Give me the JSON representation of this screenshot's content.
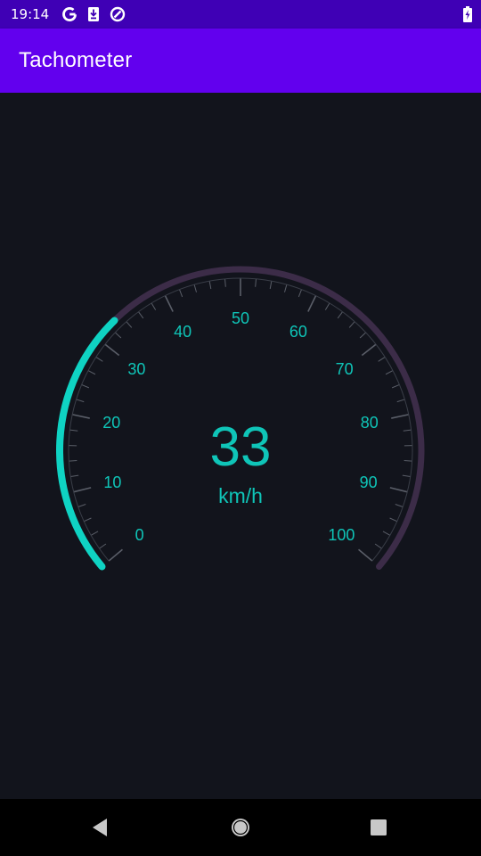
{
  "status_bar": {
    "time": "19:14",
    "icons": [
      "google-icon",
      "download-icon",
      "data-saver-icon",
      "battery-charging-icon"
    ]
  },
  "app_bar": {
    "title": "Tachometer"
  },
  "gauge": {
    "min": 0,
    "max": 100,
    "major_step": 10,
    "value": 33,
    "value_text": "33",
    "unit": "km/h",
    "tick_labels": [
      "0",
      "10",
      "20",
      "30",
      "40",
      "50",
      "60",
      "70",
      "80",
      "90",
      "100"
    ],
    "colors": {
      "progress": "#0fd3c3",
      "track": "#3c2c48",
      "ticks": "#5a5e68",
      "text": "#0fc5b8",
      "background": "#12141c"
    }
  },
  "nav_bar": {
    "back": "back-icon",
    "home": "home-icon",
    "recents": "recents-icon"
  }
}
